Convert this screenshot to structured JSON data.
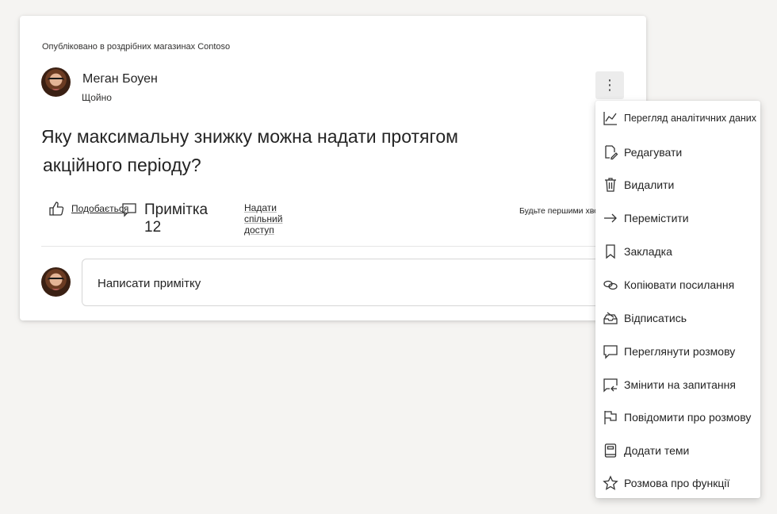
{
  "post": {
    "community_line": "Опубліковано в роздрібних магазинах Contoso",
    "author_name": "Меган Боуен",
    "timestamp": "Щойно",
    "question_line1": "Яку максимальну знижку можна надати протягом",
    "question_line2": "акційного періоду?",
    "actions": {
      "like_label": "Подобається",
      "comment_label": "Примітка 12",
      "share_label": "Надати спільний доступ"
    },
    "reactions_hint": "Будьте першими хворими",
    "reply_placeholder": "Написати примітку"
  },
  "more_button": {
    "icon": "more-vertical-icon",
    "glyph": "⋮"
  },
  "menu": {
    "items": [
      {
        "label": "Перегляд аналітичних даних",
        "icon": "analytics-icon"
      },
      {
        "label": "Редагувати",
        "icon": "edit-icon"
      },
      {
        "label": "Видалити",
        "icon": "delete-icon"
      },
      {
        "label": "Перемістити",
        "icon": "move-arrow-icon"
      },
      {
        "label": "Закладка",
        "icon": "bookmark-icon"
      },
      {
        "label": "Копіювати посилання",
        "icon": "link-icon"
      },
      {
        "label": "Відписатись",
        "icon": "unfollow-inbox-icon"
      },
      {
        "label": "Переглянути розмову",
        "icon": "conversation-icon"
      },
      {
        "label": "Змінити на запитання",
        "icon": "change-to-question-icon"
      },
      {
        "label": "Повідомити про розмову",
        "icon": "flag-icon"
      },
      {
        "label": "Додати теми",
        "icon": "topics-book-icon"
      },
      {
        "label": "Розмова про функції",
        "icon": "star-icon"
      }
    ]
  }
}
